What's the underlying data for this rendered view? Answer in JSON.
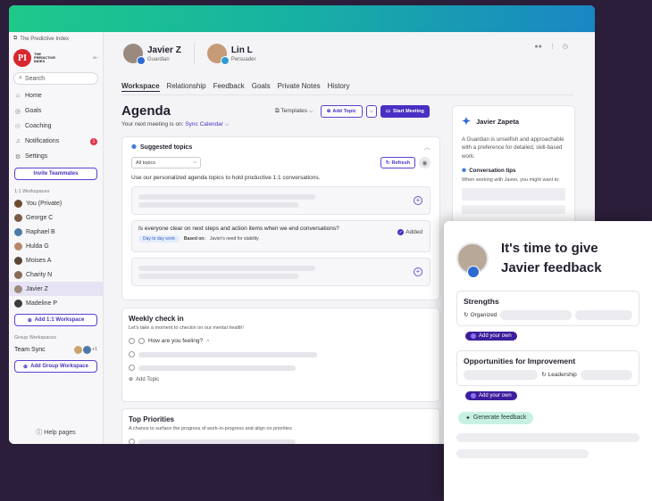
{
  "sidebar": {
    "brand_top": "The Predictive Index",
    "logo_letters": "PI",
    "logo_text": "THE PREDICTIVE INDEX",
    "search": "Search",
    "nav": [
      {
        "label": "Home",
        "icon": "home-icon"
      },
      {
        "label": "Goals",
        "icon": "target-icon"
      },
      {
        "label": "Coaching",
        "icon": "coaching-icon"
      },
      {
        "label": "Notifications",
        "icon": "bell-icon",
        "badge": "1"
      },
      {
        "label": "Settings",
        "icon": "gear-icon"
      }
    ],
    "invite": "Invite Teammates",
    "one_on_one_label": "1:1 Workspaces",
    "workspaces": [
      "You (Private)",
      "George C",
      "Raphael B",
      "Hulda G",
      "Moises A",
      "Charity N",
      "Javier Z",
      "Madeline P"
    ],
    "add_one_on_one": "Add 1:1 Workspace",
    "group_label": "Group Workspaces",
    "team": {
      "name": "Team Sync",
      "extra": "+1"
    },
    "add_group": "Add Group Workspace",
    "help": "Help pages"
  },
  "header": {
    "people": [
      {
        "name": "Javier Z",
        "role": "Guardian"
      },
      {
        "name": "Lin L",
        "role": "Persuader"
      }
    ],
    "tabs": [
      "Workspace",
      "Relationship",
      "Feedback",
      "Goals",
      "Private Notes",
      "History"
    ],
    "active_tab": "Workspace"
  },
  "agenda": {
    "title": "Agenda",
    "next_meeting_prefix": "Your next meeting is on:",
    "next_meeting_link": "Sync Calendar",
    "templates": "Templates",
    "add_topic": "Add Topic",
    "start_meeting": "Start Meeting"
  },
  "suggested": {
    "title": "Suggested topics",
    "filter": "All topics",
    "refresh": "Refresh",
    "description": "Use our personalized agenda topics to hold productive 1:1 conversations.",
    "question": "Is everyone clear on next steps and action items when we end conversations?",
    "chip": "Day to day work",
    "based_on_label": "Based on:",
    "based_on_value": "Javier's need for stability",
    "added": "Added"
  },
  "weekly": {
    "title": "Weekly check in",
    "subtitle": "Let's take a moment to checkin on our mental health!",
    "item": "How are you feeling?",
    "add_topic": "Add Topic"
  },
  "priorities": {
    "title": "Top Priorities",
    "subtitle": "A chance to surface the progress of work-in-progress and align on priorities"
  },
  "profile": {
    "name": "Javier Zapeta",
    "description": "A Guardian is unselfish and approachable with a preference for detailed, skill-based work.",
    "tips_title": "Conversation tips",
    "tips_sub": "When working with Javier, you might want to:"
  },
  "feedback": {
    "title_line1": "It's time to give",
    "title_line2": "Javier feedback",
    "strengths": "Strengths",
    "strength_tag": "Organized",
    "add_own": "Add your own",
    "improvement": "Opportunities for Improvement",
    "improvement_tag": "Leadership",
    "generate": "Generate feedback"
  },
  "colors": {
    "accent": "#4a2fc4",
    "brand_red": "#d6282e",
    "background": "#2b1e3a"
  }
}
